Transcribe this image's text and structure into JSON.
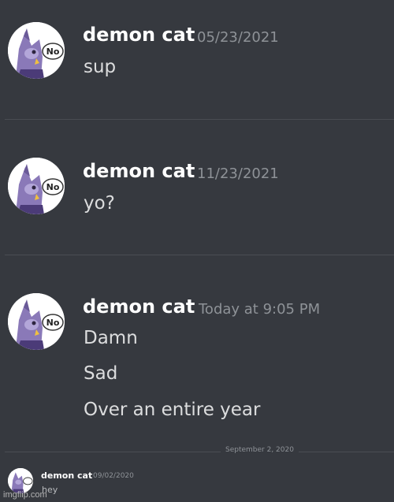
{
  "messages": [
    {
      "username": "demon cat",
      "timestamp": "05/23/2021",
      "avatar_icon": "demon-cat-avatar-icon",
      "avatar_badge": "No",
      "lines": [
        "sup"
      ]
    },
    {
      "username": "demon cat",
      "timestamp": "11/23/2021",
      "avatar_icon": "demon-cat-avatar-icon",
      "avatar_badge": "No",
      "lines": [
        "yo?"
      ]
    },
    {
      "username": "demon cat",
      "timestamp": "Today at 9:05 PM",
      "avatar_icon": "demon-cat-avatar-icon",
      "avatar_badge": "No",
      "lines": [
        "Damn",
        "Sad",
        "Over an entire year"
      ]
    }
  ],
  "date_divider": "September 2, 2020",
  "old_message": {
    "username": "demon cat",
    "timestamp": "09/02/2020",
    "avatar_icon": "demon-cat-avatar-icon",
    "lines": [
      "hey"
    ]
  },
  "watermark": "imgflip.com",
  "colors": {
    "background": "#36393f",
    "username": "#ffffff",
    "timestamp": "#8e9297",
    "message_text": "#dcddde",
    "divider": "#4a4d53"
  }
}
